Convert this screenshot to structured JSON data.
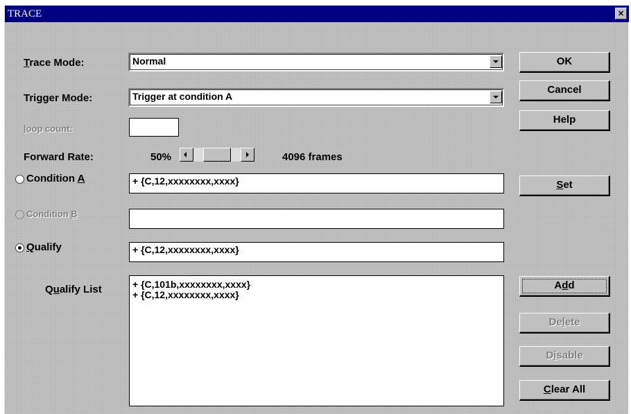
{
  "window": {
    "title": "TRACE",
    "close_glyph": "×"
  },
  "labels": {
    "trace_mode": {
      "before": "",
      "key": "T",
      "after": "race Mode:"
    },
    "trigger_mode": {
      "before": "Tri",
      "key": "g",
      "after": "ger Mode:"
    },
    "loop_count": {
      "before": "",
      "key": "l",
      "after": "oop count:"
    },
    "forward_rate": "Forward Rate:",
    "condition_a": {
      "before": "Condition ",
      "key": "A",
      "after": ""
    },
    "condition_b": {
      "before": "Condition ",
      "key": "B",
      "after": ""
    },
    "qualify": {
      "before": "",
      "key": "Q",
      "after": "ualify"
    },
    "qualify_list": {
      "before": "Q",
      "key": "u",
      "after": "alify List"
    }
  },
  "fields": {
    "trace_mode_value": "Normal",
    "trigger_mode_value": "Trigger at condition A",
    "loop_count_value": "",
    "condition_a_value": "+ {C,12,xxxxxxxx,xxxx}",
    "condition_b_value": "",
    "qualify_value": "+ {C,12,xxxxxxxx,xxxx}"
  },
  "forward_rate": {
    "percent": "50%",
    "frames": "4096  frames",
    "position_fraction": 0.5
  },
  "radios": {
    "condition_a": {
      "checked": false,
      "enabled": true
    },
    "condition_b": {
      "checked": false,
      "enabled": false
    },
    "qualify": {
      "checked": true,
      "enabled": true
    }
  },
  "qualify_list": [
    "+ {C,101b,xxxxxxxx,xxxx}",
    "+ {C,12,xxxxxxxx,xxxx}"
  ],
  "buttons": {
    "ok": "OK",
    "cancel": "Cancel",
    "help": "Help",
    "set": {
      "before": "",
      "key": "S",
      "after": "et"
    },
    "add": {
      "before": "A",
      "key": "d",
      "after": "d"
    },
    "delete": {
      "before": "De",
      "key": "l",
      "after": "ete"
    },
    "disable": {
      "before": "D",
      "key": "i",
      "after": "sable"
    },
    "clear_all": {
      "before": "",
      "key": "C",
      "after": "lear All"
    }
  },
  "icons": {
    "close": "close-icon",
    "dropdown": "chevron-down-icon",
    "scroll_left": "arrow-left-icon",
    "scroll_right": "arrow-right-icon"
  }
}
